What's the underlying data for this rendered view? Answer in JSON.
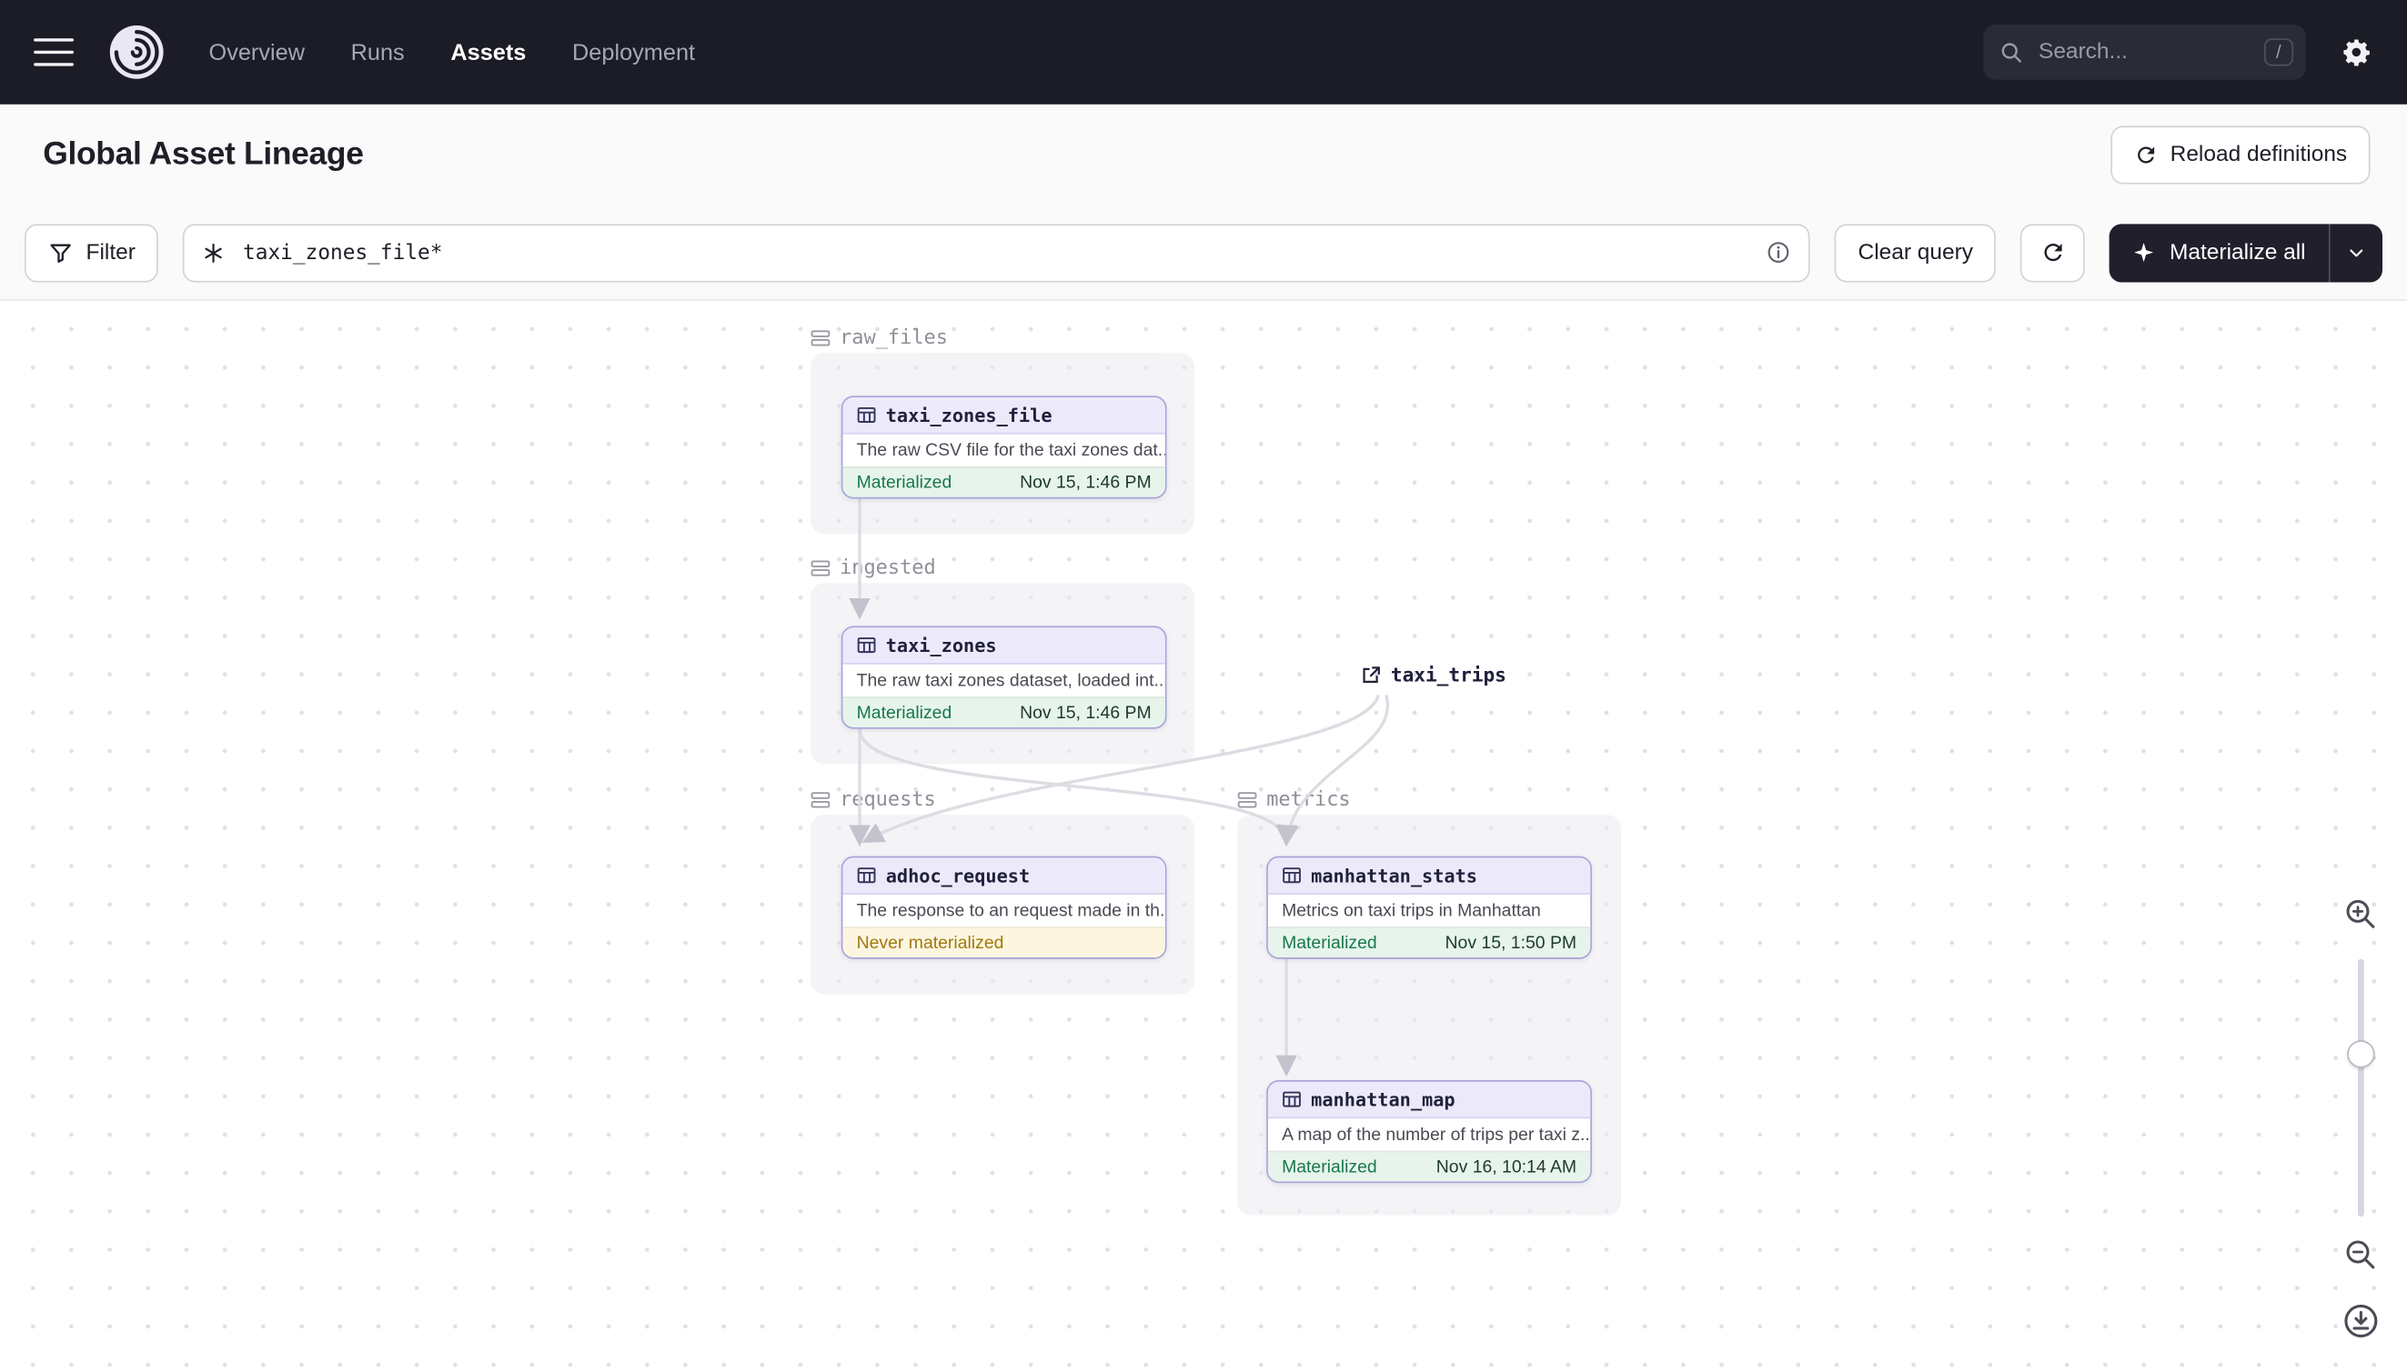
{
  "navbar": {
    "links": [
      "Overview",
      "Runs",
      "Assets",
      "Deployment"
    ],
    "active_link": "Assets",
    "search": {
      "placeholder": "Search...",
      "shortcut": "/"
    }
  },
  "page": {
    "title": "Global Asset Lineage",
    "reload_button": "Reload definitions"
  },
  "toolbar": {
    "filter_button": "Filter",
    "query_value": "taxi_zones_file*",
    "clear_query_button": "Clear query",
    "materialize_button": "Materialize all"
  },
  "lineage": {
    "groups": [
      {
        "name": "raw_files"
      },
      {
        "name": "ingested"
      },
      {
        "name": "requests"
      },
      {
        "name": "metrics"
      }
    ],
    "nodes": [
      {
        "name": "taxi_zones_file",
        "description": "The raw CSV file for the taxi zones dat...",
        "status": "Materialized",
        "timestamp": "Nov 15, 1:46 PM"
      },
      {
        "name": "taxi_zones",
        "description": "The raw taxi zones dataset, loaded int...",
        "status": "Materialized",
        "timestamp": "Nov 15, 1:46 PM"
      },
      {
        "name": "adhoc_request",
        "description": "The response to an request made in th...",
        "status": "Never materialized",
        "timestamp": ""
      },
      {
        "name": "manhattan_stats",
        "description": "Metrics on taxi trips in Manhattan",
        "status": "Materialized",
        "timestamp": "Nov 15, 1:50 PM"
      },
      {
        "name": "manhattan_map",
        "description": "A map of the number of trips per taxi z...",
        "status": "Materialized",
        "timestamp": "Nov 16, 10:14 AM"
      }
    ],
    "external_assets": [
      {
        "name": "taxi_trips"
      }
    ],
    "edges": [
      [
        "taxi_zones_file",
        "taxi_zones"
      ],
      [
        "taxi_zones",
        "adhoc_request"
      ],
      [
        "taxi_zones",
        "manhattan_stats"
      ],
      [
        "taxi_trips",
        "adhoc_request"
      ],
      [
        "taxi_trips",
        "manhattan_stats"
      ],
      [
        "manhattan_stats",
        "manhattan_map"
      ]
    ]
  },
  "colors": {
    "navbar_bg": "#1C1C27",
    "node_header": "#ECEAFA",
    "node_border": "#A8A4D9",
    "materialized_green": "#17784A",
    "never_materialized_amber": "#A1790B",
    "edge_gray": "#DCDCE3"
  }
}
